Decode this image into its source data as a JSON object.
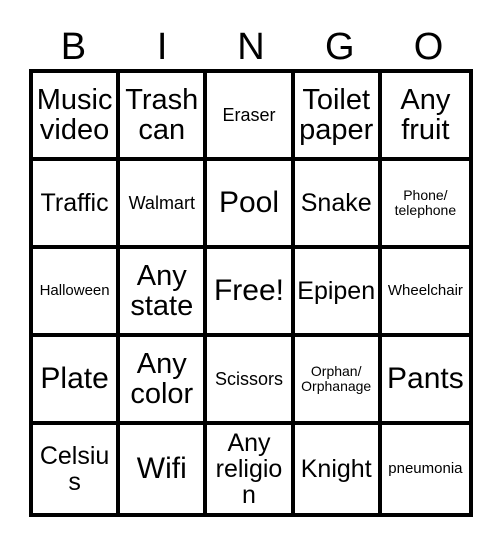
{
  "card": {
    "title": "BINGO",
    "header_letters": [
      "B",
      "I",
      "N",
      "G",
      "O"
    ],
    "free_space_label": "Free!",
    "colors": {
      "grid_line": "#000000",
      "cell_background": "#ffffff",
      "text": "#000000",
      "page_background": "#ffffff"
    },
    "rows": [
      [
        {
          "text": "Music\nvideo",
          "size": "lg"
        },
        {
          "text": "Trash\ncan",
          "size": "lg"
        },
        {
          "text": "Eraser",
          "size": "sm"
        },
        {
          "text": "Toilet\npaper",
          "size": "lg"
        },
        {
          "text": "Any\nfruit",
          "size": "lg"
        }
      ],
      [
        {
          "text": "Traffic",
          "size": "md"
        },
        {
          "text": "Walmart",
          "size": "sm"
        },
        {
          "text": "Pool",
          "size": "xl"
        },
        {
          "text": "Snake",
          "size": "md"
        },
        {
          "text": "Phone/\ntelephone",
          "size": "xxs"
        }
      ],
      [
        {
          "text": "Halloween",
          "size": "xs"
        },
        {
          "text": "Any\nstate",
          "size": "lg"
        },
        {
          "text": "Free!",
          "size": "xl"
        },
        {
          "text": "Epipen",
          "size": "md"
        },
        {
          "text": "Wheelchair",
          "size": "xs"
        }
      ],
      [
        {
          "text": "Plate",
          "size": "xl"
        },
        {
          "text": "Any\ncolor",
          "size": "lg"
        },
        {
          "text": "Scissors",
          "size": "sm"
        },
        {
          "text": "Orphan/\nOrphanage",
          "size": "xxs"
        },
        {
          "text": "Pants",
          "size": "xl"
        }
      ],
      [
        {
          "text": "Celsius",
          "size": "md"
        },
        {
          "text": "Wifi",
          "size": "xl"
        },
        {
          "text": "Any\nreligion",
          "size": "md"
        },
        {
          "text": "Knight",
          "size": "md"
        },
        {
          "text": "pneumonia",
          "size": "xs"
        }
      ]
    ]
  }
}
